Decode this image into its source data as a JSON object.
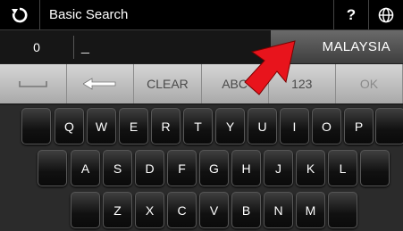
{
  "titlebar": {
    "title": "Basic Search",
    "help_label": "?"
  },
  "input": {
    "count": "0",
    "text": "_",
    "country": "MALAYSIA"
  },
  "func_keys": [
    "",
    "",
    "CLEAR",
    "ABC",
    "123",
    "OK"
  ],
  "rows": {
    "row1": [
      "",
      "Q",
      "W",
      "E",
      "R",
      "T",
      "Y",
      "U",
      "I",
      "O",
      "P",
      ""
    ],
    "row2": [
      "",
      "A",
      "S",
      "D",
      "F",
      "G",
      "H",
      "J",
      "K",
      "L",
      ""
    ],
    "row3": [
      "",
      "Z",
      "X",
      "C",
      "V",
      "B",
      "N",
      "M",
      ""
    ]
  },
  "colors": {
    "accent_arrow": "#e8141c",
    "func_bar": "#bdbdbd",
    "key_bg": "#111111"
  }
}
